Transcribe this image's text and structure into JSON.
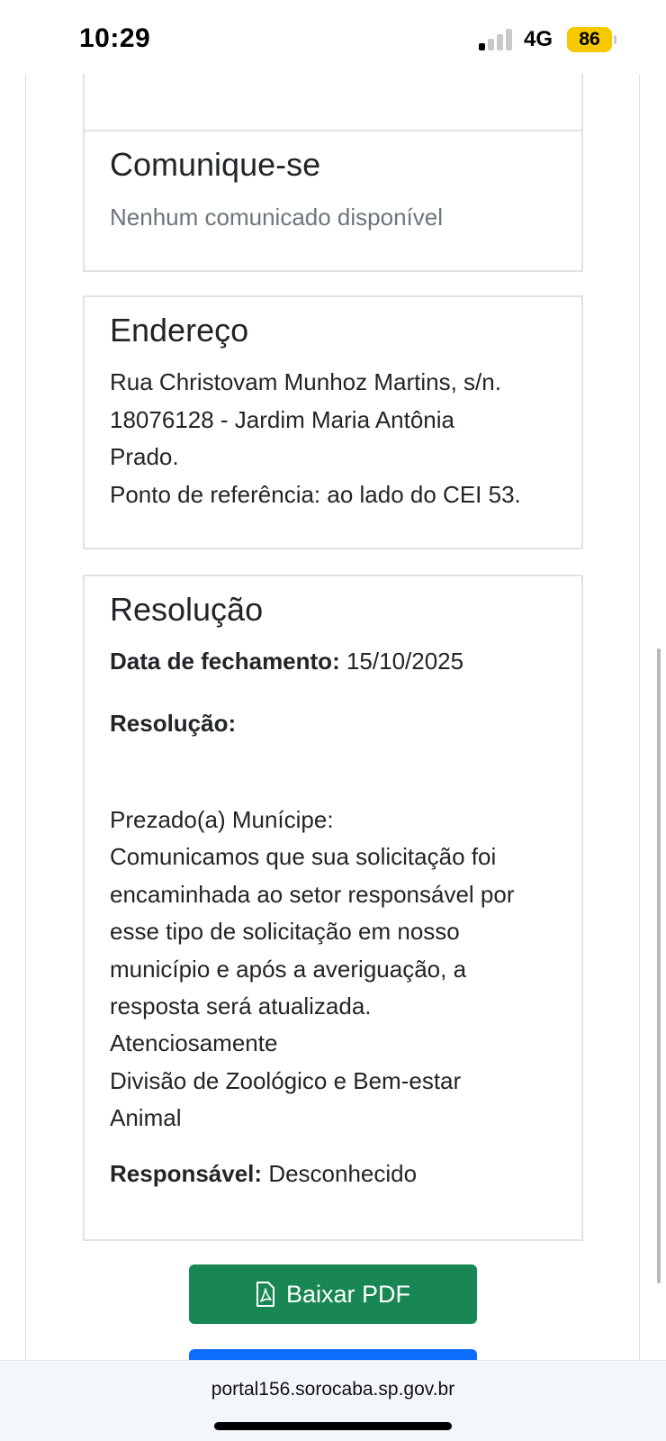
{
  "status_bar": {
    "time": "10:29",
    "network": "4G",
    "battery": "86",
    "battery_color": "#f5c800"
  },
  "cards": {
    "comunique": {
      "title": "Comunique-se",
      "empty_text": "Nenhum comunicado disponível"
    },
    "endereco": {
      "title": "Endereço",
      "lines": [
        "Rua Christovam Munhoz Martins, s/n.",
        "18076128 - Jardim Maria Antônia",
        "Prado.",
        "Ponto de referência: ao lado do CEI 53."
      ]
    },
    "resolucao": {
      "title": "Resolução",
      "closing_date_label": "Data de fechamento:",
      "closing_date": "15/10/2025",
      "resolution_label": "Resolução:",
      "resolution_lines": [
        "Prezado(a) Munícipe:",
        "Comunicamos que sua solicitação foi",
        "encaminhada ao setor responsável por",
        "esse tipo de solicitação em nosso",
        "município e após a averiguação, a",
        "resposta será atualizada.",
        "Atenciosamente",
        "Divisão de Zoológico e Bem-estar",
        "Animal"
      ],
      "responsible_label": "Responsável:",
      "responsible": "Desconhecido"
    }
  },
  "buttons": {
    "pdf_label": "Baixar PDF",
    "pdf_icon": "file-pdf-icon",
    "pdf_color": "#198754",
    "next_color": "#0d6efd"
  },
  "browser": {
    "url": "portal156.sorocaba.sp.gov.br"
  }
}
